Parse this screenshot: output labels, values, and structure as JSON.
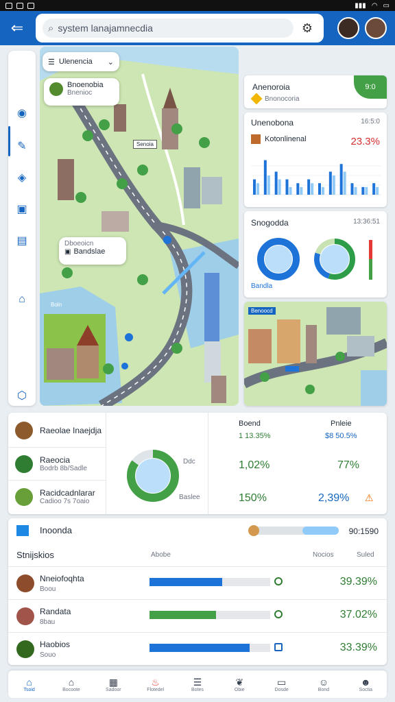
{
  "search": {
    "value": "system lanajamnecdia"
  },
  "map": {
    "layer_selector": "Ulenencia",
    "popup_top": {
      "title": "Bnoenobia",
      "subtitle": "Bnenioc"
    },
    "popup_mid": {
      "title": "Dboeoicn",
      "subtitle": "Bandslae"
    },
    "label_box": "Senoia",
    "corner_label": "Boln"
  },
  "panels": {
    "card1": {
      "title": "Anenoroia",
      "detail": "Bnonocoria",
      "badge": "9:0"
    },
    "card2": {
      "title": "Unenobona",
      "stamp": "16:5:0",
      "label": "Kotonlinenal",
      "value": "23.3%",
      "chart_data": {
        "type": "bar",
        "series": [
          {
            "name": "",
            "values": [
              4,
              9,
              6,
              4,
              3,
              4,
              3,
              6,
              8,
              3,
              2,
              3
            ]
          },
          {
            "name": "",
            "values": [
              3,
              5,
              4,
              2,
              2,
              3,
              2,
              5,
              6,
              2,
              2,
              2
            ]
          }
        ],
        "ylim": [
          0,
          10
        ]
      }
    },
    "card3": {
      "title": "Snogodda",
      "stamp": "13:36:51",
      "foot": "Bandla",
      "chart_data": [
        {
          "type": "pie",
          "values": [
            100
          ],
          "colors": [
            "#1e73d8"
          ]
        },
        {
          "type": "pie",
          "values": [
            55,
            25,
            20
          ],
          "colors": [
            "#2e9d4a",
            "#1e73d8",
            "#c9e2b3"
          ]
        }
      ]
    },
    "card4": {
      "label": "Benoocd"
    }
  },
  "stats": {
    "rows": [
      {
        "name": "Raeolae Inaejdja",
        "sub": ""
      },
      {
        "name": "Raeocia",
        "sub": "Bodrb 8b/Sadle"
      },
      {
        "name": "Racidcadnlarar",
        "sub": "Cadioo 7s 7oaio"
      }
    ],
    "donut_label": "Ddc",
    "donut_sub": "Baslee",
    "chart_data": {
      "type": "pie",
      "values": [
        85,
        15
      ],
      "colors": [
        "#43a047",
        "#dfe4e8"
      ]
    },
    "col1": {
      "header": "Boend",
      "subvalue": "1 13.35%",
      "v1": "1,02%",
      "v2": "150%"
    },
    "col2": {
      "header": "Pnleie",
      "subvalue": "$8 50.5%",
      "v1": "77%",
      "v2": "2,39%"
    }
  },
  "progress": {
    "title": "Inoonda",
    "slider_value": 0.42,
    "slider_readout": "90:1590",
    "subtitle": "Stnijskios",
    "col_a": "Abobe",
    "col_b": "Nocios",
    "col_c": "Suled",
    "rows": [
      {
        "name": "Nneiofoqhta",
        "sub": "Boou",
        "fill": 0.6,
        "color": "#1e73d8",
        "value": "39.39%"
      },
      {
        "name": "Randata",
        "sub": "8bau",
        "fill": 0.55,
        "color": "#43a047",
        "value": "37.02%"
      },
      {
        "name": "Haobios",
        "sub": "Souo",
        "fill": 0.83,
        "color": "#1e73d8",
        "value": "33.39%"
      }
    ]
  },
  "bottom_nav": [
    {
      "label": "Tsoid",
      "icon": "home-icon"
    },
    {
      "label": "Bocoote",
      "icon": "house-icon"
    },
    {
      "label": "Sadoor",
      "icon": "calendar-icon"
    },
    {
      "label": "Flotedel",
      "icon": "flame-icon"
    },
    {
      "label": "Botes",
      "icon": "list-icon"
    },
    {
      "label": "Obie",
      "icon": "leaf-icon"
    },
    {
      "label": "Dosde",
      "icon": "inbox-icon"
    },
    {
      "label": "Bond",
      "icon": "user-icon"
    },
    {
      "label": "Soctia",
      "icon": "person-icon"
    }
  ]
}
